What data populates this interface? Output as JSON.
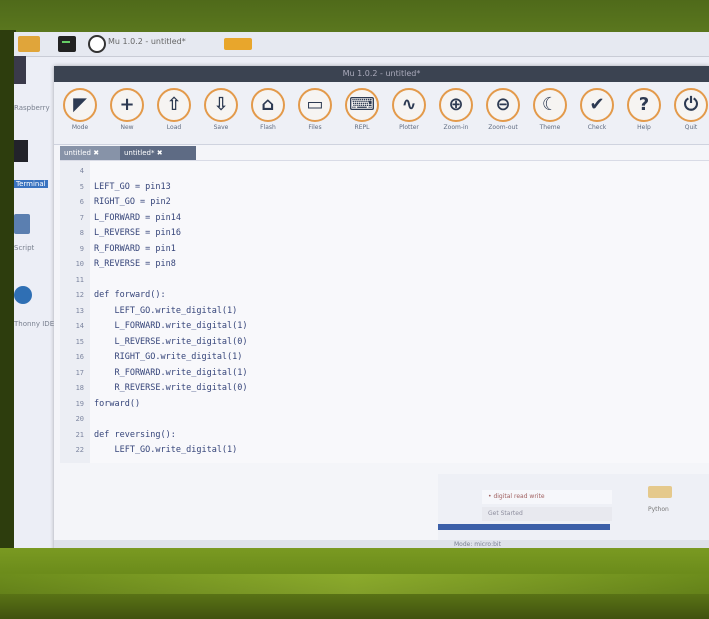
{
  "taskbar": {
    "icons": [
      "folder-icon",
      "terminal-icon",
      "mu-icon"
    ],
    "active_label": "Mu 1.0.2 - untitled*"
  },
  "desktop": {
    "icons": [
      {
        "name": "desktop-icon-top",
        "label": "Raspberry"
      },
      {
        "name": "desktop-icon-terminal",
        "label": "Terminal"
      },
      {
        "name": "desktop-icon-script",
        "label": "Script"
      },
      {
        "name": "desktop-icon-ide",
        "label": "Thonny IDE"
      }
    ]
  },
  "window": {
    "title": "Mu 1.0.2 - untitled*"
  },
  "toolbar": {
    "buttons": [
      {
        "label": "Mode",
        "icon": "mode-icon"
      },
      {
        "label": "New",
        "icon": "plus-icon"
      },
      {
        "label": "Load",
        "icon": "upload-icon"
      },
      {
        "label": "Save",
        "icon": "download-icon"
      },
      {
        "label": "Flash",
        "icon": "flash-icon"
      },
      {
        "label": "Files",
        "icon": "files-icon"
      },
      {
        "label": "REPL",
        "icon": "keyboard-icon"
      },
      {
        "label": "Plotter",
        "icon": "pulse-icon"
      },
      {
        "label": "Zoom-in",
        "icon": "zoom-in-icon"
      },
      {
        "label": "Zoom-out",
        "icon": "zoom-out-icon"
      },
      {
        "label": "Theme",
        "icon": "moon-icon"
      },
      {
        "label": "Check",
        "icon": "thumbs-up-icon"
      },
      {
        "label": "Help",
        "icon": "help-icon"
      },
      {
        "label": "Quit",
        "icon": "power-icon"
      }
    ]
  },
  "tabs": [
    {
      "label": "untitled ✖"
    },
    {
      "label": "untitled* ✖"
    }
  ],
  "editor": {
    "lines": [
      {
        "n": "4",
        "text": ""
      },
      {
        "n": "5",
        "text": "LEFT_GO = pin13"
      },
      {
        "n": "6",
        "text": "RIGHT_GO = pin2"
      },
      {
        "n": "7",
        "text": "L_FORWARD = pin14"
      },
      {
        "n": "8",
        "text": "L_REVERSE = pin16"
      },
      {
        "n": "9",
        "text": "R_FORWARD = pin1"
      },
      {
        "n": "10",
        "text": "R_REVERSE = pin8"
      },
      {
        "n": "11",
        "text": ""
      },
      {
        "n": "12",
        "text": "def forward():"
      },
      {
        "n": "13",
        "text": "    LEFT_GO.write_digital(1)"
      },
      {
        "n": "14",
        "text": "    L_FORWARD.write_digital(1)"
      },
      {
        "n": "15",
        "text": "    L_REVERSE.write_digital(0)"
      },
      {
        "n": "16",
        "text": "    RIGHT_GO.write_digital(1)"
      },
      {
        "n": "17",
        "text": "    R_FORWARD.write_digital(1)"
      },
      {
        "n": "18",
        "text": "    R_REVERSE.write_digital(0)"
      },
      {
        "n": "19",
        "text": "forward()"
      },
      {
        "n": "20",
        "text": ""
      },
      {
        "n": "21",
        "text": "def reversing():"
      },
      {
        "n": "22",
        "text": "    LEFT_GO.write_digital(1)"
      }
    ]
  },
  "status": {
    "dropdown_primary": "• digital read write",
    "dropdown_secondary": "Get Started",
    "pin_button_label": "Python",
    "footer": "Mode: micro:bit"
  }
}
